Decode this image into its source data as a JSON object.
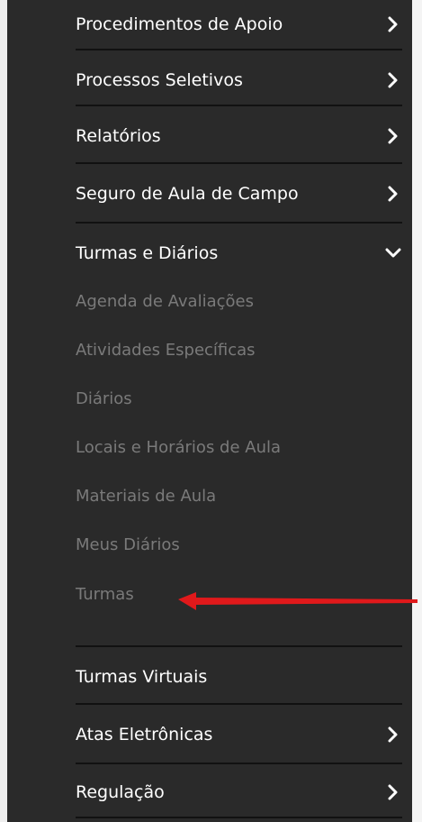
{
  "menu": {
    "items": [
      {
        "label": "Procedimentos de Apoio",
        "icon": "chevron-right-icon"
      },
      {
        "label": "Processos Seletivos",
        "icon": "chevron-right-icon"
      },
      {
        "label": "Relatórios",
        "icon": "chevron-right-icon"
      },
      {
        "label": "Seguro de Aula de Campo",
        "icon": "chevron-right-icon"
      },
      {
        "label": "Turmas e Diários",
        "icon": "chevron-down-icon"
      }
    ],
    "submenu": [
      "Agenda de Avaliações",
      "Atividades Específicas",
      "Diários",
      "Locais e Horários de Aula",
      "Materiais de Aula",
      "Meus Diários",
      "Turmas"
    ],
    "items_after": [
      {
        "label": "Turmas Virtuais",
        "icon": ""
      },
      {
        "label": "Atas Eletrônicas",
        "icon": "chevron-right-icon"
      },
      {
        "label": "Regulação",
        "icon": "chevron-right-icon"
      }
    ]
  },
  "colors": {
    "panel_bg": "#2a2a2a",
    "divider": "#111111",
    "item_text": "#ffffff",
    "subitem_text": "#7a7a7a",
    "annotation_arrow": "#e0191b"
  }
}
